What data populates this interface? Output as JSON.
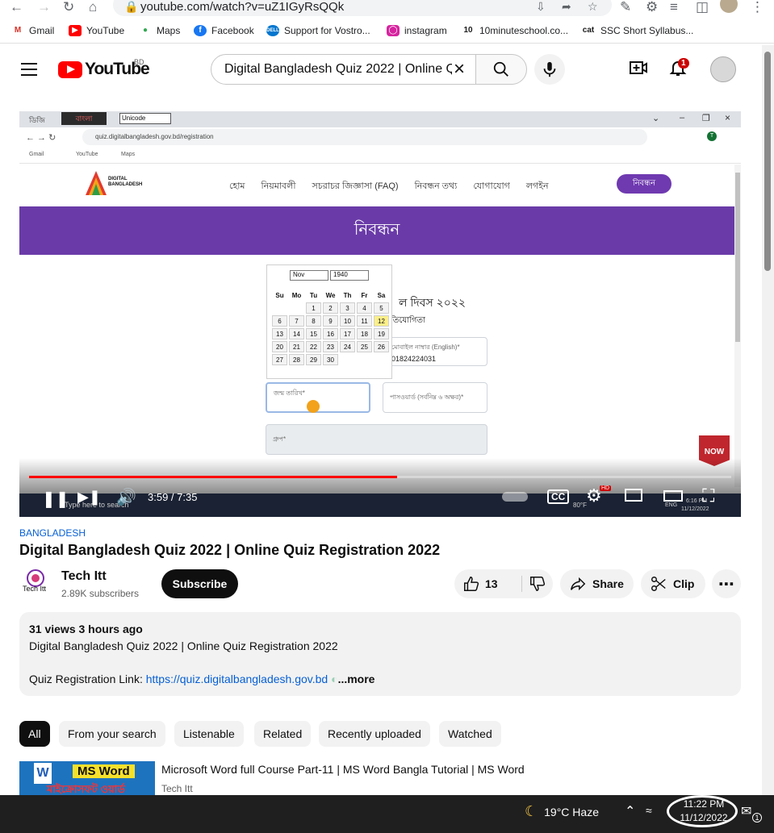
{
  "browser": {
    "url": "youtube.com/watch?v=uZ1IGyRsQQk",
    "bookmarks": [
      "Gmail",
      "YouTube",
      "Maps",
      "Facebook",
      "Support for Vostro...",
      "instagram",
      "10minuteschool.co...",
      "SSC Short Syllabus..."
    ]
  },
  "youtube": {
    "logo_text": "YouTube",
    "country_code": "BD",
    "search_value": "Digital Bangladesh Quiz 2022 | Online Qu",
    "notification_count": "1"
  },
  "video_content": {
    "site_url": "quiz.digitalbangladesh.gov.bd/registration",
    "ime_label": "বাংলা",
    "ime_select": "Unicode",
    "site_tab_prefix": "ডিজি",
    "bookmarks": [
      "Gmail",
      "YouTube",
      "Maps"
    ],
    "logo_line1": "DIGITAL",
    "logo_line2": "BANGLADESH",
    "nav_links": [
      "হোম",
      "নিয়মাবলী",
      "সচরাচর জিজ্ঞাসা (FAQ)",
      "নিবন্ধন তথ্য",
      "যোগাযোগ",
      "লগইন"
    ],
    "register_button": "নিবন্ধন",
    "banner_title": "নিবন্ধন",
    "form_heading": "ল দিবস ২০২২",
    "form_subheading": "তিযোগিতা",
    "mobile_label": "মোবাইল নাম্বার (English)*",
    "mobile_value": "01824224031",
    "dob_label": "জন্ম তারিখ*",
    "password_label": "পাসওয়ার্ড (সর্বনিম্ন ৬ অক্ষর)*",
    "group_label": "গ্রুপ*",
    "calendar": {
      "month": "Nov",
      "year": "1940",
      "weekdays": [
        "Su",
        "Mo",
        "Tu",
        "We",
        "Th",
        "Fr",
        "Sa"
      ],
      "weeks": [
        [
          "",
          "",
          "1",
          "2",
          "3",
          "4",
          "5"
        ],
        [
          "6",
          "7",
          "8",
          "9",
          "10",
          "11",
          "12"
        ],
        [
          "13",
          "14",
          "15",
          "16",
          "17",
          "18",
          "19"
        ],
        [
          "20",
          "21",
          "22",
          "23",
          "24",
          "25",
          "26"
        ],
        [
          "27",
          "28",
          "29",
          "30",
          "",
          "",
          ""
        ]
      ],
      "highlighted": "12"
    },
    "subscribe_badge": "NOW",
    "taskbar_search": "Type here to search",
    "inner_weather": "80°F",
    "inner_lang": "ENG",
    "inner_time": "6:16 PM",
    "inner_date": "11/12/2022"
  },
  "player": {
    "time_display": "3:59 / 7:35",
    "progress_fraction": 0.524,
    "hd_badge": "HD"
  },
  "video": {
    "hashtag": "BANGLADESH",
    "title": "Digital Bangladesh Quiz 2022 | Online Quiz Registration 2022",
    "channel_name": "Tech Itt",
    "avatar_text": "Tech Itt",
    "subscribers": "2.89K subscribers",
    "subscribe_label": "Subscribe",
    "like_count": "13",
    "share_label": "Share",
    "clip_label": "Clip",
    "meta": "31 views  3 hours ago",
    "description_line1": "Digital Bangladesh Quiz 2022 | Online Quiz Registration 2022",
    "description_prefix": "Quiz Registration Link: ",
    "description_link": "https://quiz.digitalbangladesh.gov.bd",
    "more_label": "...more"
  },
  "chips": [
    "All",
    "From your search",
    "Listenable",
    "Related",
    "Recently uploaded",
    "Watched"
  ],
  "recommendation": {
    "title": "Microsoft Word full Course Part-11 | MS Word Bangla Tutorial | MS Word",
    "channel": "Tech Itt",
    "thumb_text": "MS Word",
    "thumb_sub": "মাইক্রোসফট ওয়ার্ড"
  },
  "taskbar": {
    "weather": "19°C  Haze",
    "time": "11:22 PM",
    "date": "11/12/2022",
    "notif_count": "1"
  }
}
